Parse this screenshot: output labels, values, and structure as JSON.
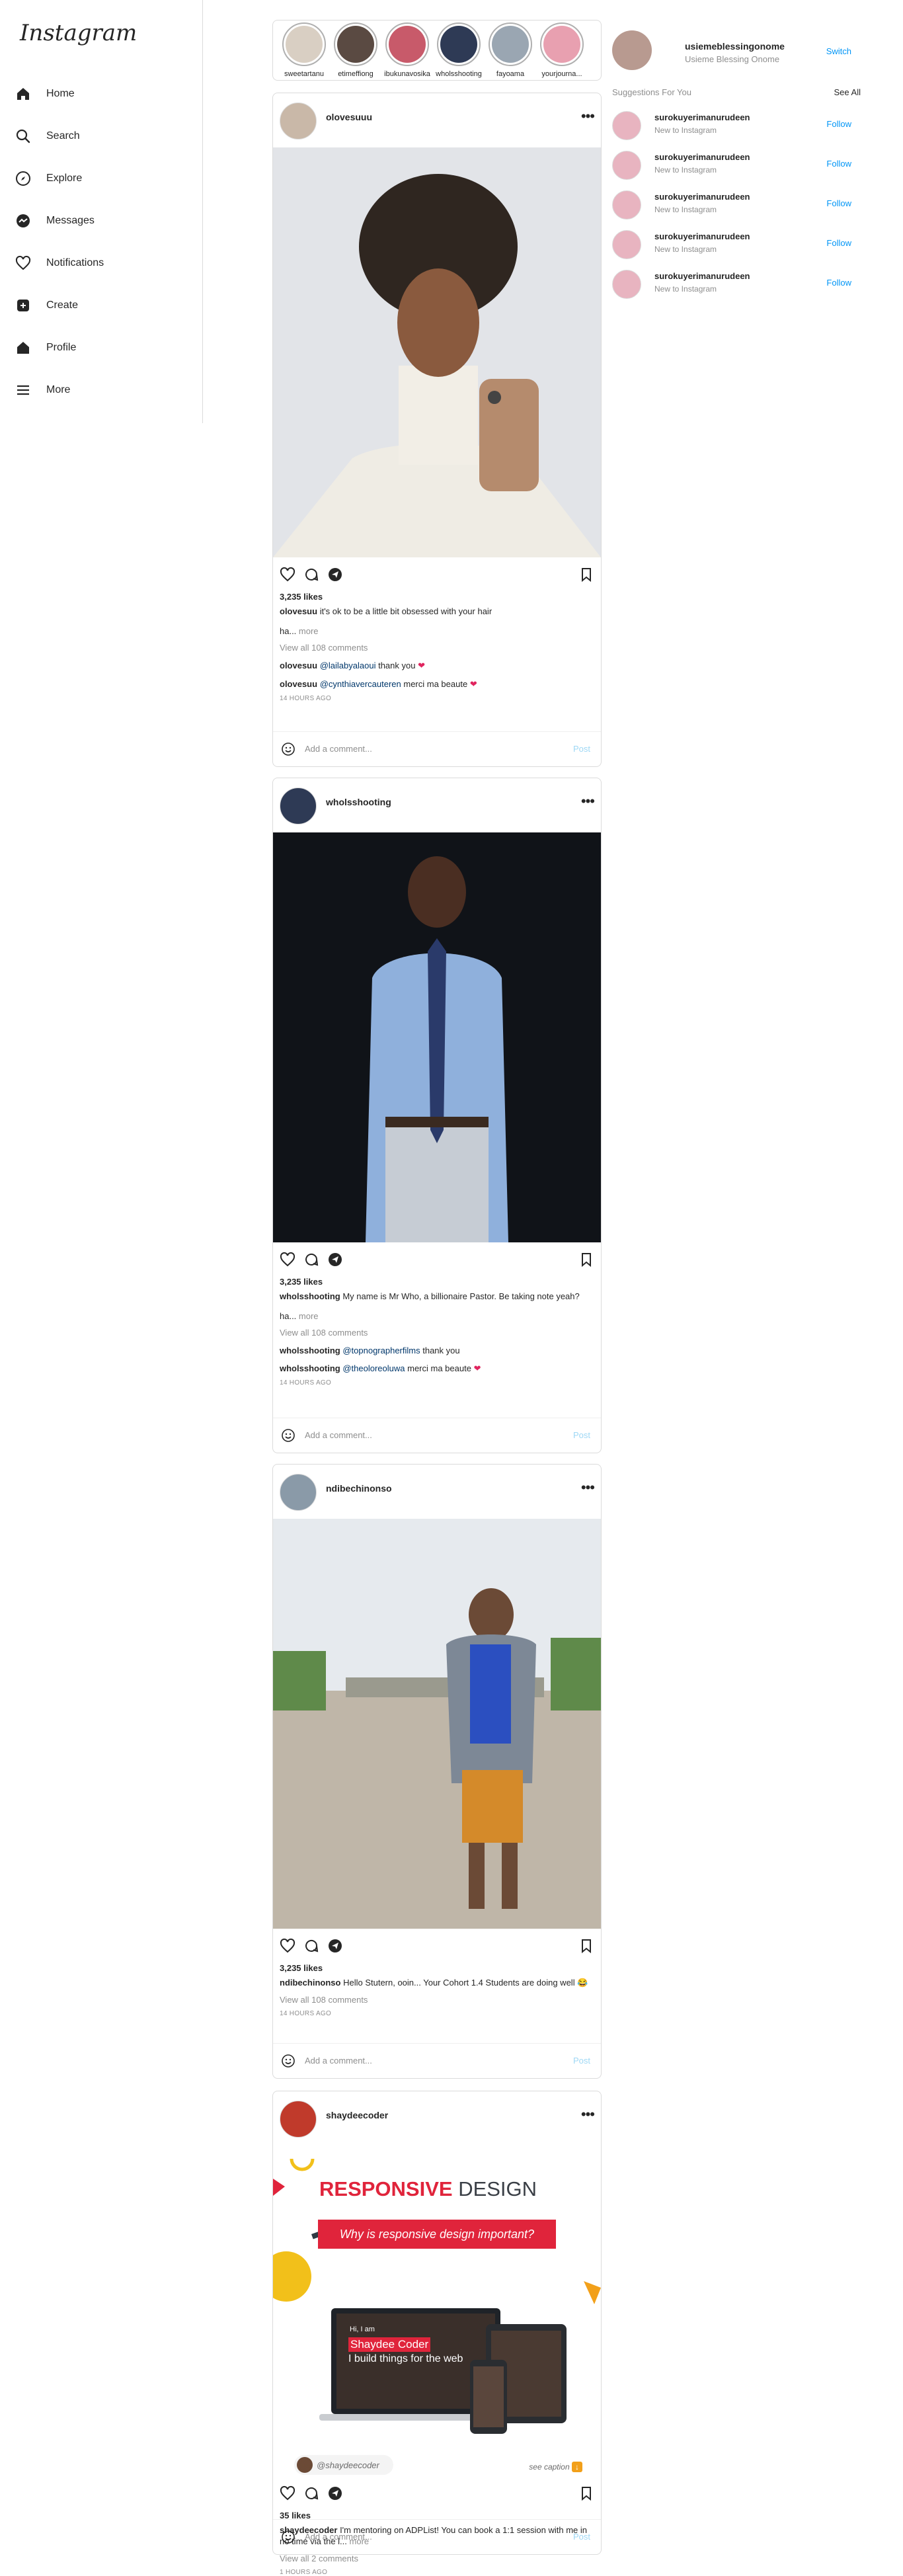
{
  "app": {
    "logo_text": "Instagram"
  },
  "sidebar": {
    "items": [
      {
        "label": "Home",
        "icon": "home-icon"
      },
      {
        "label": "Search",
        "icon": "search-icon"
      },
      {
        "label": "Explore",
        "icon": "compass-icon"
      },
      {
        "label": "Messages",
        "icon": "messenger-icon"
      },
      {
        "label": "Notifications",
        "icon": "heart-icon"
      },
      {
        "label": "Create",
        "icon": "plus-square-icon"
      },
      {
        "label": "Profile",
        "icon": "profile-icon"
      },
      {
        "label": "More",
        "icon": "menu-icon"
      }
    ]
  },
  "stories": [
    {
      "name": "sweetartanu",
      "color": "#d9cfc3"
    },
    {
      "name": "etimeffiong",
      "color": "#5a4a42"
    },
    {
      "name": "ibukunavosika",
      "color": "#c85a6a"
    },
    {
      "name": "wholsshooting",
      "color": "#2e3a55"
    },
    {
      "name": "fayoama",
      "color": "#9aa6b2"
    },
    {
      "name": "yourjourna...",
      "color": "#e8a0b0"
    }
  ],
  "posts": [
    {
      "username": "olovesuuu",
      "likes": "3,235 likes",
      "caption_user": "olovesuu",
      "caption_text": "it's ok to be a little bit obsessed with your hair",
      "more_prefix": "ha...",
      "more_label": "more",
      "view_all": "View all 108 comments",
      "comments": [
        {
          "user": "olovesuu",
          "mention": "@lailabyalaoui",
          "text": "thank you"
        },
        {
          "user": "olovesuu",
          "mention": "@cynthiavercauteren",
          "text": "merci ma beaute"
        }
      ],
      "time": "14 HOURS AGO",
      "add_comment_placeholder": "Add a comment...",
      "post_label": "Post"
    },
    {
      "username": "wholsshooting",
      "likes": "3,235 likes",
      "caption_user": "wholsshooting",
      "caption_text": "My name is Mr Who, a billionaire Pastor. Be taking note yeah?",
      "more_prefix": "ha...",
      "more_label": "more",
      "view_all": "View all 108 comments",
      "comments": [
        {
          "user": "wholsshooting",
          "mention": "@topnographerfilms",
          "text": "thank you"
        },
        {
          "user": "wholsshooting",
          "mention": "@theoloreoluwa",
          "text": "merci ma beaute"
        }
      ],
      "time": "14 HOURS AGO",
      "add_comment_placeholder": "Add a comment...",
      "post_label": "Post"
    },
    {
      "username": "ndibechinonso",
      "likes": "3,235 likes",
      "caption_user": "ndibechinonso",
      "caption_text": "Hello Stutern, ooin... Your Cohort 1.4 Students are doing well 😂",
      "view_all": "View all 108 comments",
      "time": "14 HOURS AGO",
      "add_comment_placeholder": "Add a comment...",
      "post_label": "Post"
    },
    {
      "username": "shaydeecoder",
      "likes": "35 likes",
      "caption_user": "shaydeecoder",
      "caption_text": "I'm mentoring on ADPList! You can book a 1:1 session with me in no time via the l...",
      "more_label": "more",
      "view_all": "View all 2 comments",
      "time": "1 HOURS AGO",
      "add_comment_placeholder": "Add a comment...",
      "post_label": "Post",
      "media": {
        "title_red": "RESPONSIVE",
        "title_grey": "DESIGN",
        "subtitle": "Why is responsive design important?",
        "screen_line1": "Hi, I am",
        "screen_name": "Shaydee Coder",
        "screen_line2": "I build things for the web",
        "handle": "@shaydeecoder",
        "see_caption": "see caption"
      }
    }
  ],
  "right": {
    "me_username": "usiemeblessingonome",
    "me_name": "Usieme Blessing Onome",
    "switch_label": "Switch",
    "suggestions_title": "Suggestions For You",
    "see_all_label": "See All",
    "suggestions": [
      {
        "username": "surokuyerimanurudeen",
        "sub": "New to Instagram",
        "follow": "Follow"
      },
      {
        "username": "surokuyerimanurudeen",
        "sub": "New to Instagram",
        "follow": "Follow"
      },
      {
        "username": "surokuyerimanurudeen",
        "sub": "New to Instagram",
        "follow": "Follow"
      },
      {
        "username": "surokuyerimanurudeen",
        "sub": "New to Instagram",
        "follow": "Follow"
      },
      {
        "username": "surokuyerimanurudeen",
        "sub": "New to Instagram",
        "follow": "Follow"
      }
    ]
  }
}
